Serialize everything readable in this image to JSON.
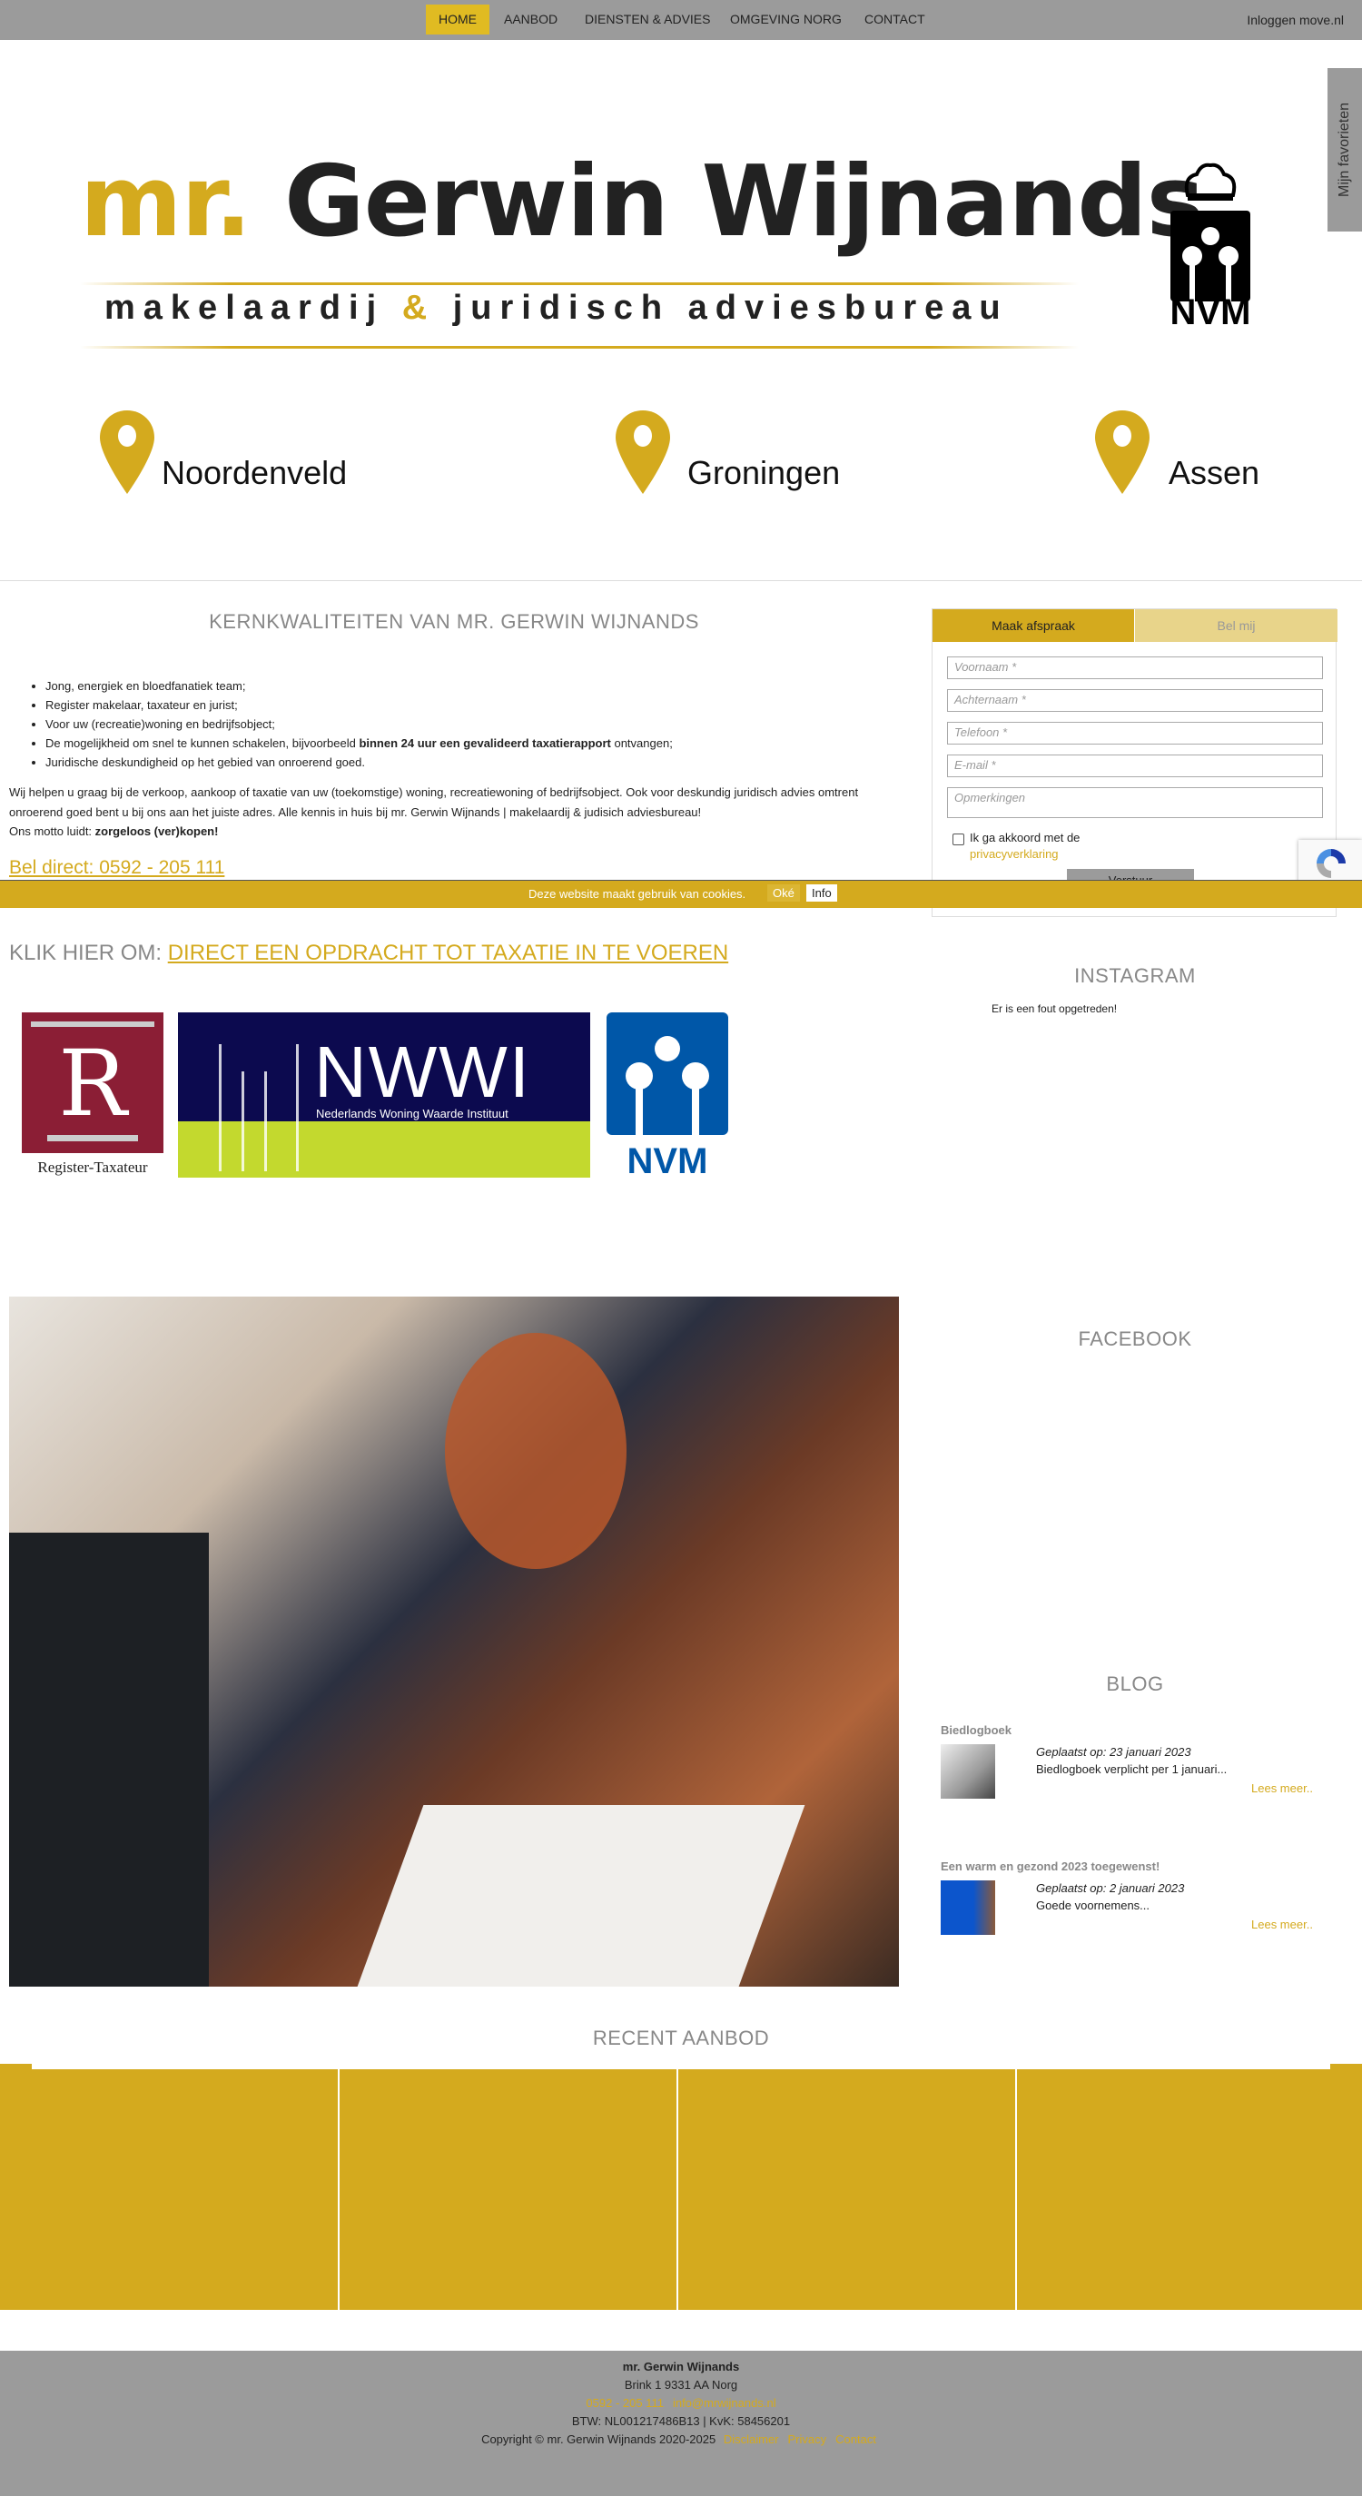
{
  "nav": {
    "items": [
      {
        "label": "HOME",
        "active": true
      },
      {
        "label": "AANBOD"
      },
      {
        "label": "DIENSTEN & ADVIES"
      },
      {
        "label": "OMGEVING NORG"
      },
      {
        "label": "CONTACT"
      }
    ],
    "login": "Inloggen move.nl"
  },
  "favorites_tab": "Mijn favorieten",
  "logo": {
    "mr": "mr.",
    "name1": "Gerwin",
    "name2": "Wijnands",
    "sub1": "makelaardij",
    "amp": "&",
    "sub2": "juridisch adviesbureau",
    "nvm": "NVM"
  },
  "locations": [
    "Noordenveld",
    "Groningen",
    "Assen"
  ],
  "kern": {
    "heading": "KERNKWALITEITEN VAN MR. GERWIN WIJNANDS",
    "bullets": [
      "Jong, energiek en bloedfanatiek team;",
      "Register makelaar, taxateur en jurist;",
      "Voor uw (recreatie)woning en bedrijfsobject;"
    ],
    "bullet4_pre": "De mogelijkheid om snel te kunnen schakelen, bijvoorbeeld ",
    "bullet4_bold": "binnen 24 uur een gevalideerd taxatierapport",
    "bullet4_post": " ontvangen;",
    "bullet5": "Juridische deskundigheid op het gebied van onroerend goed.",
    "para1": "Wij helpen u graag bij de verkoop, aankoop of taxatie van uw (toekomstige) woning, recreatiewoning of bedrijfsobject. Ook voor deskundig juridisch advies omtrent onroerend goed bent u bij ons aan het juiste adres. Alle kennis in huis bij mr. Gerwin Wijnands | makelaardij & judisich adviesbureau!",
    "motto_pre": "Ons motto luidt: ",
    "motto_bold": "zorgeloos (ver)kopen!",
    "phone": "Bel direct: 0592 - 205 111"
  },
  "form": {
    "tab_active": "Maak afspraak",
    "tab_inactive": "Bel mij",
    "fields": [
      "Voornaam *",
      "Achternaam *",
      "Telefoon *",
      "E-mail *"
    ],
    "remarks": "Opmerkingen",
    "agree": "Ik ga akkoord met de",
    "privacy": "privacyverklaring",
    "submit": "Verstuur"
  },
  "cookie": {
    "text": "Deze website maakt gebruik van cookies.",
    "ok": "Oké",
    "info": "Info"
  },
  "klik": {
    "pre": "KLIK HIER OM: ",
    "link": "DIRECT EEN OPDRACHT TOT TAXATIE IN TE VOEREN"
  },
  "badges": {
    "register": "Register-Taxateur",
    "nwwi": "NWWI",
    "nwwi_sub": "Nederlands Woning Waarde Instituut",
    "nvm": "NVM"
  },
  "instagram": {
    "heading": "INSTAGRAM",
    "error": "Er is een fout opgetreden!"
  },
  "facebook": {
    "heading": "FACEBOOK"
  },
  "blog": {
    "heading": "BLOG",
    "items": [
      {
        "title": "Biedlogboek",
        "date": "Geplaatst op: 23 januari 2023",
        "excerpt": "Biedlogboek verplicht per 1 januari...",
        "more": "Lees meer.."
      },
      {
        "title": "Een warm en gezond 2023 toegewenst!",
        "date": "Geplaatst op: 2 januari 2023",
        "excerpt": "Goede voornemens...",
        "more": "Lees meer.."
      }
    ]
  },
  "recent": {
    "heading": "RECENT AANBOD"
  },
  "footer": {
    "name": "mr. Gerwin Wijnands",
    "address": "Brink 1   9331 AA Norg",
    "phone": "0592 - 205 111",
    "email": "info@mrwijnands.nl",
    "btw": "BTW: NL001217486B13 | KvK: 58456201",
    "copyright": "Copyright © mr. Gerwin Wijnands 2020-2025",
    "links": [
      "Disclaimer",
      "Privacy",
      "Contact"
    ]
  },
  "colors": {
    "gold": "#d4aa1e",
    "nav_gray": "#9b9b9b",
    "tab_light": "#e8d48a"
  }
}
